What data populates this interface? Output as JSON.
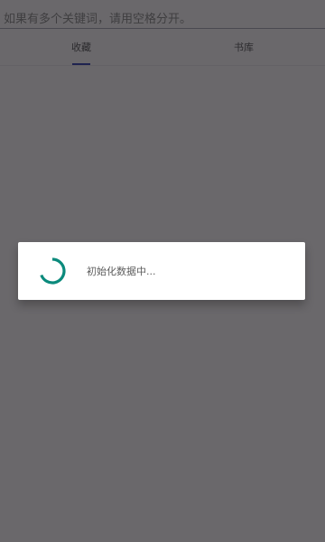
{
  "search": {
    "placeholder": "如果有多个关键词，请用空格分开。"
  },
  "tabs": [
    {
      "label": "收藏",
      "active": true
    },
    {
      "label": "书库",
      "active": false
    }
  ],
  "dialog": {
    "message": "初始化数据中..."
  },
  "colors": {
    "accent": "#1f2350",
    "spinner": "#0b8a7c"
  },
  "icons": {
    "spinner": "loading-spinner-icon"
  }
}
